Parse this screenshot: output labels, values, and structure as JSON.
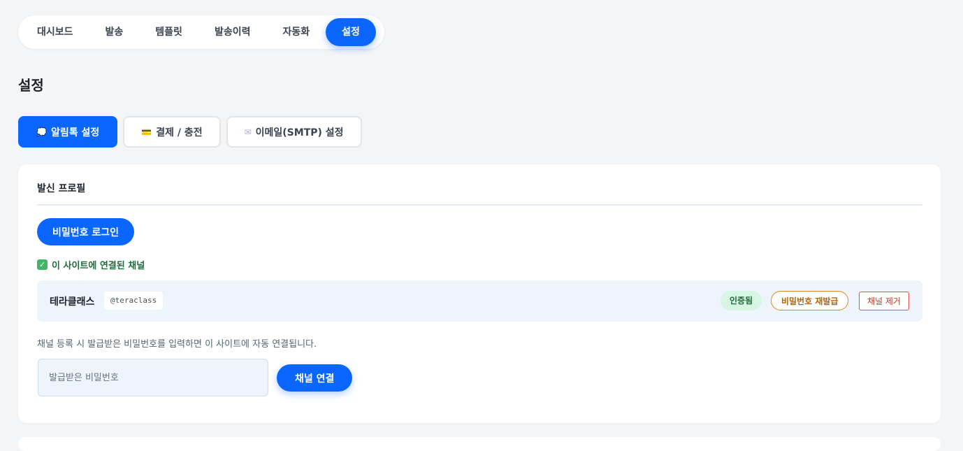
{
  "nav": {
    "items": [
      {
        "label": "대시보드"
      },
      {
        "label": "발송"
      },
      {
        "label": "템플릿"
      },
      {
        "label": "발송이력"
      },
      {
        "label": "자동화"
      },
      {
        "label": "설정"
      }
    ],
    "active_index": 5
  },
  "page_title": "설정",
  "tabs": [
    {
      "icon": "speech-bubble-icon",
      "glyph": "💭",
      "label": "알림톡 설정"
    },
    {
      "icon": "credit-card-icon",
      "glyph": "💳",
      "label": "결제 / 충전"
    },
    {
      "icon": "envelope-icon",
      "glyph": "✉",
      "label": "이메일(SMTP) 설정"
    }
  ],
  "sender_profile": {
    "title": "발신 프로필",
    "login_button": "비밀번호 로그인",
    "linked_label": "이 사이트에 연결된 채널",
    "channel": {
      "name": "테라클래스",
      "handle": "@teraclass",
      "status": "인증됨",
      "reissue_button": "비밀번호 재발급",
      "remove_button": "채널 제거"
    },
    "helper_text": "채널 등록 시 발급받은 비밀번호를 입력하면 이 사이트에 자동 연결됩니다.",
    "password_input": {
      "value": "",
      "placeholder": "발급받은 비밀번호"
    },
    "connect_button": "채널 연결"
  },
  "colors": {
    "accent": "#0a66ff",
    "success": "#3fb766",
    "warning": "#d98a1f",
    "danger": "#d9534f"
  }
}
